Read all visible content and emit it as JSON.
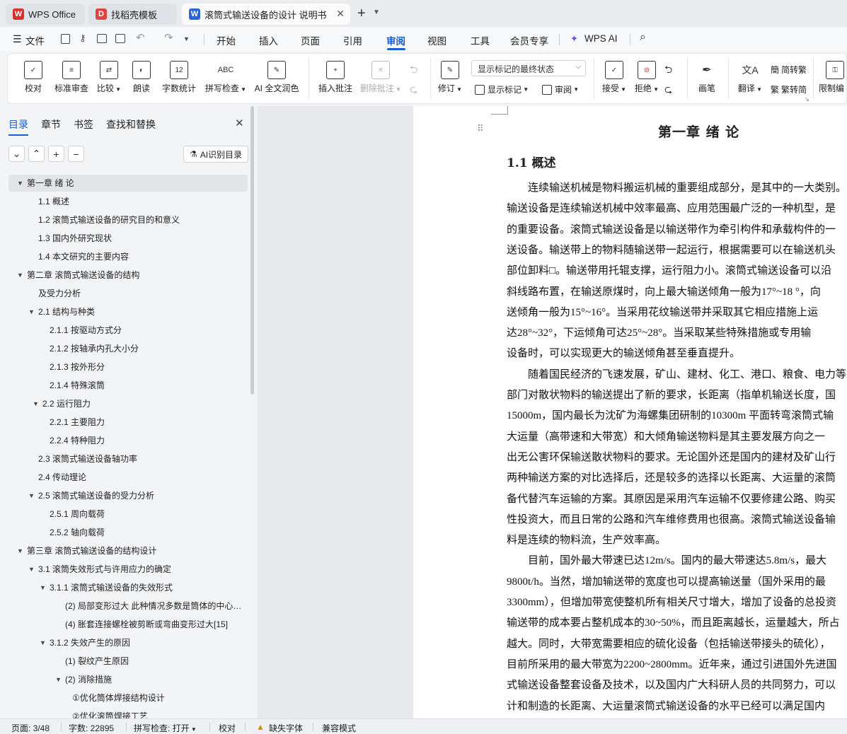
{
  "tabs": [
    {
      "label": "WPS Office",
      "icon": "wps-logo-icon",
      "color": "#d9302c"
    },
    {
      "label": "找稻壳模板",
      "icon": "docer-logo-icon",
      "color": "#e0443e"
    },
    {
      "label": "滚筒式输送设备的设计 说明书",
      "icon": "writer-logo-icon",
      "color": "#2b63d9"
    }
  ],
  "menu": {
    "file": "文件",
    "items": [
      "开始",
      "插入",
      "页面",
      "引用",
      "审阅",
      "视图",
      "工具",
      "会员专享",
      "WPS AI"
    ],
    "active": "审阅"
  },
  "ribbon": {
    "proofread": "校对",
    "standard_review": "标准审查",
    "compare": "比较",
    "read_aloud": "朗读",
    "word_count": "字数统计",
    "spell_check": "拼写检查",
    "ai_polish": "AI 全文润色",
    "insert_comment": "插入批注",
    "delete_comment": "删除批注",
    "track_changes": "修订",
    "markup_dropdown": "显示标记的最终状态",
    "show_markup": "显示标记",
    "review": "审阅",
    "accept": "接受",
    "reject": "拒绝",
    "pen": "画笔",
    "translate": "翻译",
    "to_traditional": "简转繁",
    "to_simplified": "繁转简",
    "restrict_edit": "限制编"
  },
  "nav": {
    "tabs": [
      "目录",
      "章节",
      "书签",
      "查找和替换"
    ],
    "ai_toc": "AI识别目录",
    "toc": [
      {
        "label": "第一章 绪 论",
        "level": 0,
        "caret": "▼",
        "selected": true
      },
      {
        "label": "1.1 概述",
        "level": 1
      },
      {
        "label": "1.2 滚筒式输送设备的研究目的和意义",
        "level": 1
      },
      {
        "label": "1.3 国内外研究现状",
        "level": 1
      },
      {
        "label": "1.4 本文研究的主要内容",
        "level": 1
      },
      {
        "label": "第二章 滚筒式输送设备的结构",
        "level": 0,
        "caret": "▼"
      },
      {
        "label": "及受力分析",
        "level": 1
      },
      {
        "label": "2.1 结构与种类",
        "level": 1,
        "caret": "▼"
      },
      {
        "label": "2.1.1 按驱动方式分",
        "level": 2
      },
      {
        "label": "2.1.2 按轴承内孔大小分",
        "level": 2
      },
      {
        "label": "2.1.3 按外形分",
        "level": 2
      },
      {
        "label": "2.1.4 特殊滚筒",
        "level": 2
      },
      {
        "label": "2.2 运行阻力",
        "level": 1,
        "caret": "▼",
        "shift": 6
      },
      {
        "label": "2.2.1 主要阻力",
        "level": 2
      },
      {
        "label": "2.2.4 特种阻力",
        "level": 2
      },
      {
        "label": "2.3 滚筒式输送设备轴功率",
        "level": 1
      },
      {
        "label": "2.4 传动理论",
        "level": 1
      },
      {
        "label": "2.5 滚筒式输送设备的受力分析",
        "level": 1,
        "caret": "▼"
      },
      {
        "label": "2.5.1 周向载荷",
        "level": 2
      },
      {
        "label": "2.5.2 轴向载荷",
        "level": 2
      },
      {
        "label": "第三章 滚筒式输送设备的结构设计",
        "level": 0,
        "caret": "▼"
      },
      {
        "label": "3.1 滚筒失效形式与许用应力的确定",
        "level": 1,
        "caret": "▼"
      },
      {
        "label": "3.1.1 滚筒式输送设备的失效形式",
        "level": 2,
        "caret": "▼"
      },
      {
        "label": "(2) 局部变形过大 此种情况多数是筒体的中心区域",
        "level": 3
      },
      {
        "label": "(4) 胀套连接螺栓被剪断或弯曲变形过大[15]",
        "level": 3
      },
      {
        "label": "3.1.2 失效产生的原因",
        "level": 2,
        "caret": "▼"
      },
      {
        "label": "(1) 裂纹产生原因",
        "level": 3
      },
      {
        "label": "(2) 消除措施",
        "level": 3,
        "caret": "▼"
      },
      {
        "label": "①优化筒体焊接结构设计",
        "level": 4
      },
      {
        "label": "②优化滚筒焊接工艺",
        "level": 4
      }
    ]
  },
  "document": {
    "heading1": "第一章 绪 论",
    "heading2": "1.1 概述",
    "lines": [
      "　　连续输送机械是物料搬运机械的重要组成部分，是其中的一大类别。",
      "输送设备是连续输送机械中效率最高、应用范围最广泛的一种机型，是",
      "的重要设备。滚筒式输送设备是以输送带作为牵引构件和承载构件的一",
      "送设备。输送带上的物料随输送带一起运行，根据需要可以在输送机头",
      "部位卸料□。输送带用托辊支撑，运行阻力小。滚筒式输送设备可以沿",
      "斜线路布置，在输送原煤时，向上最大输送倾角一般为17°~18 °，向",
      "送倾角一般为15°~16°。当采用花纹输送带并采取其它相应措施上运",
      "达28°~32°，下运倾角可达25°~28°。当采取某些特殊措施或专用输",
      "设备时，可以实现更大的输送倾角甚至垂直提升。",
      "　　随着国民经济的飞速发展，矿山、建材、化工、港口、粮食、电力等",
      "部门对散状物料的输送提出了新的要求，长距离（指单机输送长度，国",
      "15000m，国内最长为沈矿为海螺集团研制的10300m 平面转弯滚筒式输",
      "大运量（高带速和大带宽）和大倾角输送物料是其主要发展方向之一",
      "出无公害环保输送散状物料的要求。无论国外还是国内的建材及矿山行",
      "两种输送方案的对比选择后，还是较多的选择以长距离、大运量的滚筒",
      "备代替汽车运输的方案。其原因是采用汽车运输不仅要修建公路、购买",
      "性投资大，而且日常的公路和汽车维修费用也很高。滚筒式输送设备输",
      "料是连续的物料流，生产效率高。",
      "　　目前，国外最大带速已达12m/s。国内的最大带速达5.8m/s，最大",
      "9800t/h。当然，增加输送带的宽度也可以提高输送量（国外采用的最",
      "3300mm），但增加带宽使整机所有相关尺寸增大，增加了设备的总投资",
      "输送带的成本要占整机成本的30~50%，而且距离越长，运量越大，所占",
      "越大。同时，大带宽需要相应的硫化设备（包括输送带接头的硫化），",
      "目前所采用的最大带宽为2200~2800mm。近年来，通过引进国外先进国",
      "式输送设备整套设备及技术，以及国内广大科研人员的共同努力，可以",
      "计和制造的长距离、大运量滚筒式输送设备的水平已经可以满足国内"
    ]
  },
  "status": {
    "page": "页面: 3/48",
    "words": "字数: 22895",
    "spell": "拼写检查: 打开",
    "proof": "校对",
    "missing_font": "缺失字体",
    "compat": "兼容模式"
  }
}
